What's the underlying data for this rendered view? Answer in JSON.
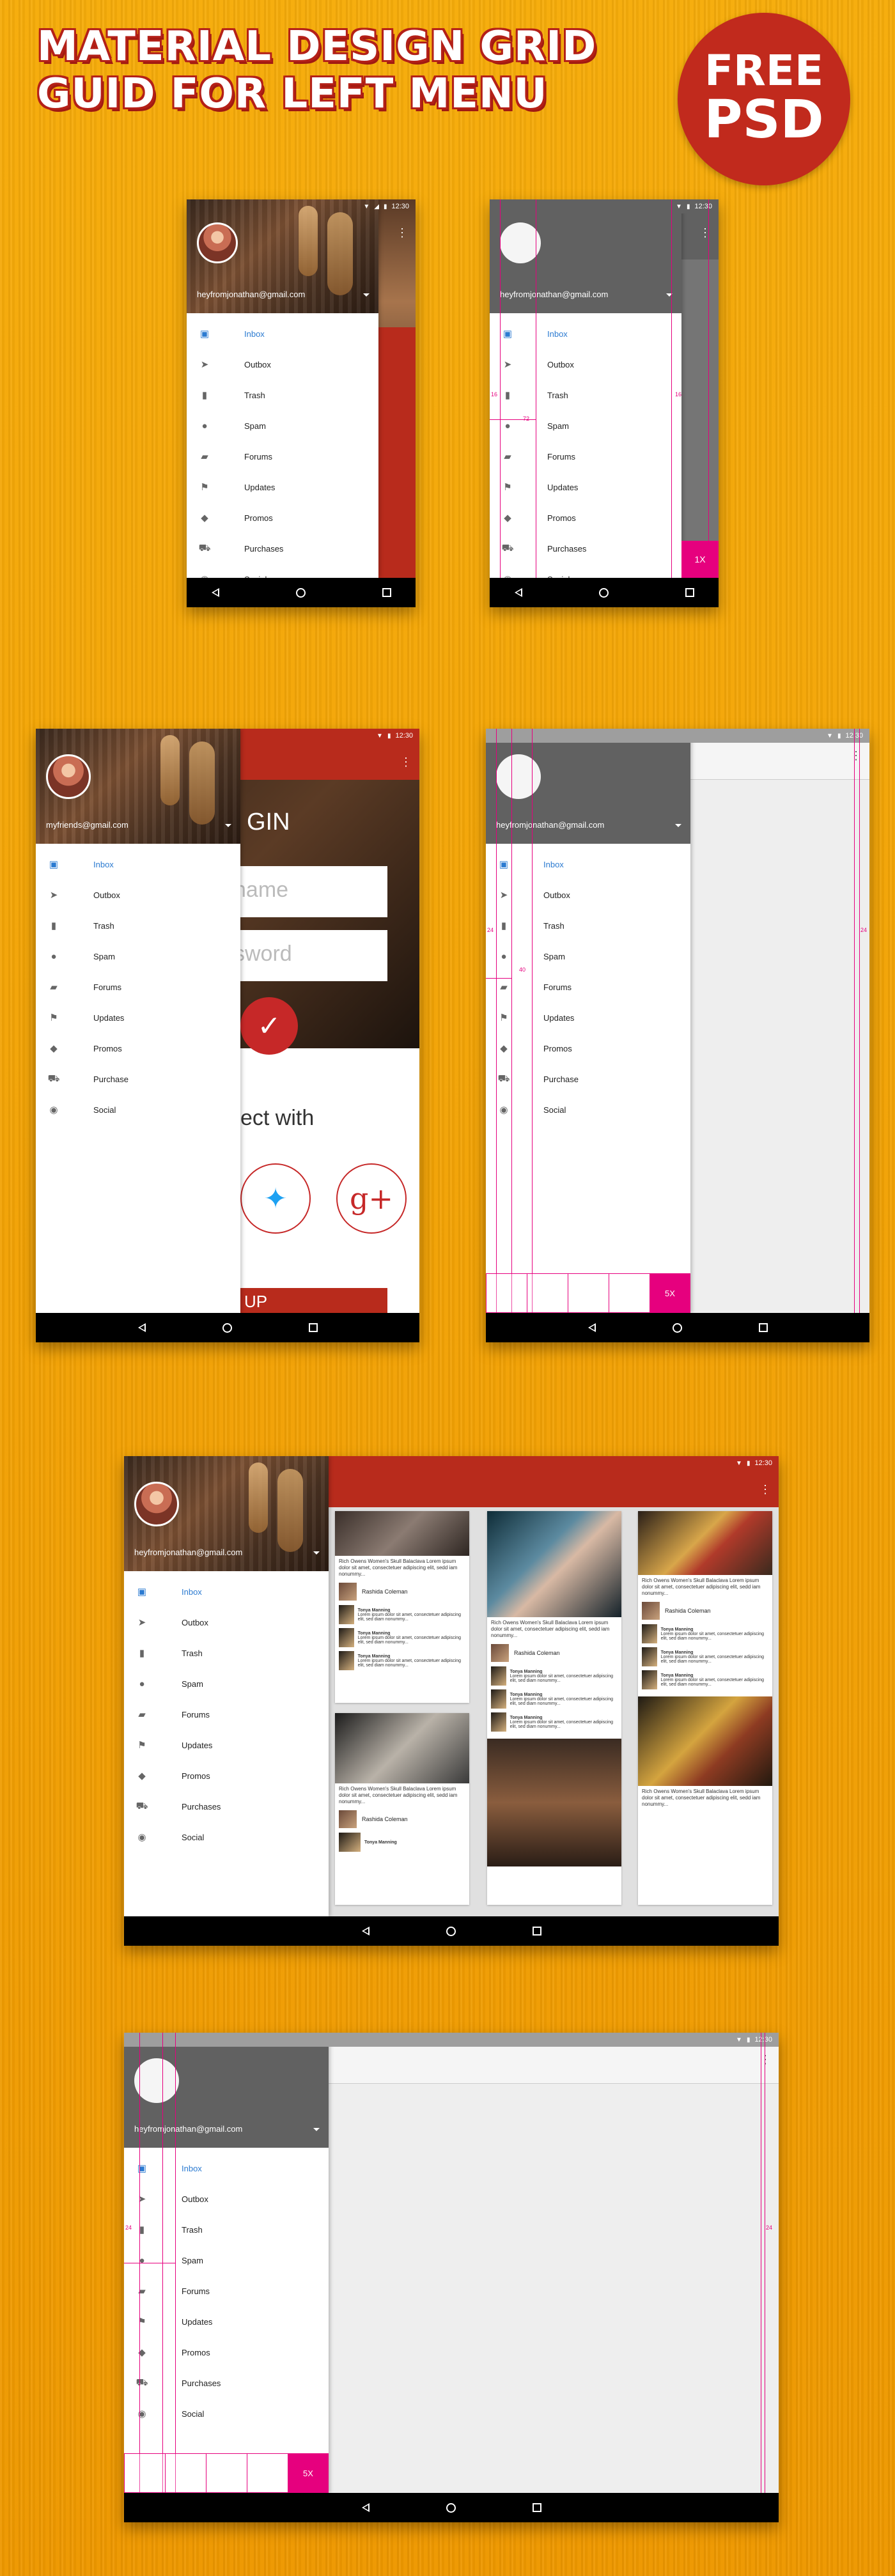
{
  "title_line1": "MATERIAL DESIGN GRID",
  "title_line2": "GUID FOR LEFT MENU",
  "badge_line1": "FREE",
  "badge_line2": "PSD",
  "status_time": "12:30",
  "email": "heyfromjonathan@gmail.com",
  "email_alt": "myfriends@gmail.com",
  "menu_items": [
    "Inbox",
    "Outbox",
    "Trash",
    "Spam",
    "Forums",
    "Updates",
    "Promos",
    "Purchases",
    "Social"
  ],
  "menu_items_alt": [
    "Inbox",
    "Outbox",
    "Trash",
    "Spam",
    "Forums",
    "Updates",
    "Promos",
    "Purchase",
    "Social"
  ],
  "menu_icons": [
    "inbox-icon",
    "send-icon",
    "trash-icon",
    "alert-icon",
    "forum-icon",
    "flag-icon",
    "tag-icon",
    "cart-icon",
    "people-icon"
  ],
  "grid_label_1x": "1X",
  "grid_label_5x": "5X",
  "guide_72": "72",
  "guide_16": "16",
  "guide_24": "24",
  "guide_40": "40",
  "login": {
    "title": "GIN",
    "username": "name",
    "password": "sword",
    "connect": "ect with",
    "signup": "N UP"
  },
  "cards": {
    "post_text": "Rich Owens Women's Skull Balaclava Lorem ipsum dolor sit amet, consectetuer adipiscing elit, sedd iam nonummy...",
    "person": "Rashida Coleman",
    "warning_name": "Tonya Manning",
    "warning_text": "Lorem ipsum dolor sit amet, consectetuer adipiscing elit, sed diam nonummy..."
  },
  "colors": {
    "background": "#f2a000",
    "title_outline": "#b42018",
    "badge": "#c12a1d",
    "appbar_red": "#b82b1c",
    "appbar_grey": "#616161",
    "guide": "#e6007e",
    "inbox_blue": "#2c7bd1"
  }
}
